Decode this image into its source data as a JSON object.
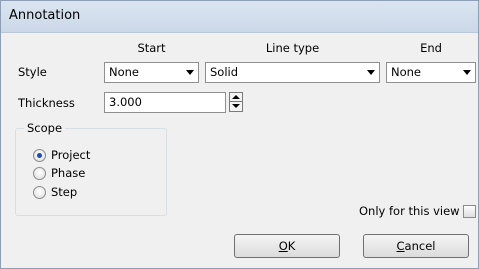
{
  "window": {
    "title": "Annotation"
  },
  "columns": {
    "start": "Start",
    "line_type": "Line type",
    "end": "End"
  },
  "style": {
    "label": "Style",
    "start_value": "None",
    "line_type_value": "Solid",
    "end_value": "None"
  },
  "thickness": {
    "label": "Thickness",
    "value": "3.000"
  },
  "scope": {
    "title": "Scope",
    "options": [
      {
        "label": "Project",
        "selected": true
      },
      {
        "label": "Phase",
        "selected": false
      },
      {
        "label": "Step",
        "selected": false
      }
    ]
  },
  "only_view": {
    "label": "Only for this view",
    "checked": false
  },
  "buttons": {
    "ok_mnemonic": "O",
    "ok_rest": "K",
    "cancel_mnemonic": "C",
    "cancel_rest": "ancel"
  }
}
